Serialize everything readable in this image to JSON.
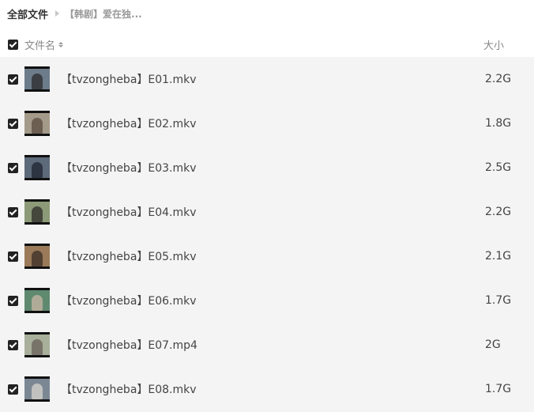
{
  "breadcrumb": {
    "root": "全部文件",
    "current": "【韩剧】爱在独..."
  },
  "header": {
    "name_label": "文件名",
    "size_label": "大小"
  },
  "files": [
    {
      "name": "【tvzongheba】E01.mkv",
      "size": "2.2G",
      "thumb_bg": "#6d7c8a",
      "thumb_fig": "#2b2b2b"
    },
    {
      "name": "【tvzongheba】E02.mkv",
      "size": "1.8G",
      "thumb_bg": "#a49a8a",
      "thumb_fig": "#5a4a3e"
    },
    {
      "name": "【tvzongheba】E03.mkv",
      "size": "2.5G",
      "thumb_bg": "#5d6a7a",
      "thumb_fig": "#1e2430"
    },
    {
      "name": "【tvzongheba】E04.mkv",
      "size": "2.2G",
      "thumb_bg": "#8c9a78",
      "thumb_fig": "#2e2a28"
    },
    {
      "name": "【tvzongheba】E05.mkv",
      "size": "2.1G",
      "thumb_bg": "#9a7a58",
      "thumb_fig": "#3a2e26"
    },
    {
      "name": "【tvzongheba】E06.mkv",
      "size": "1.7G",
      "thumb_bg": "#5f8a70",
      "thumb_fig": "#c9b6a4"
    },
    {
      "name": "【tvzongheba】E07.mp4",
      "size": "2G",
      "thumb_bg": "#a8b09c",
      "thumb_fig": "#6a6058"
    },
    {
      "name": "【tvzongheba】E08.mkv",
      "size": "1.7G",
      "thumb_bg": "#7c8794",
      "thumb_fig": "#d8d4ce"
    }
  ]
}
